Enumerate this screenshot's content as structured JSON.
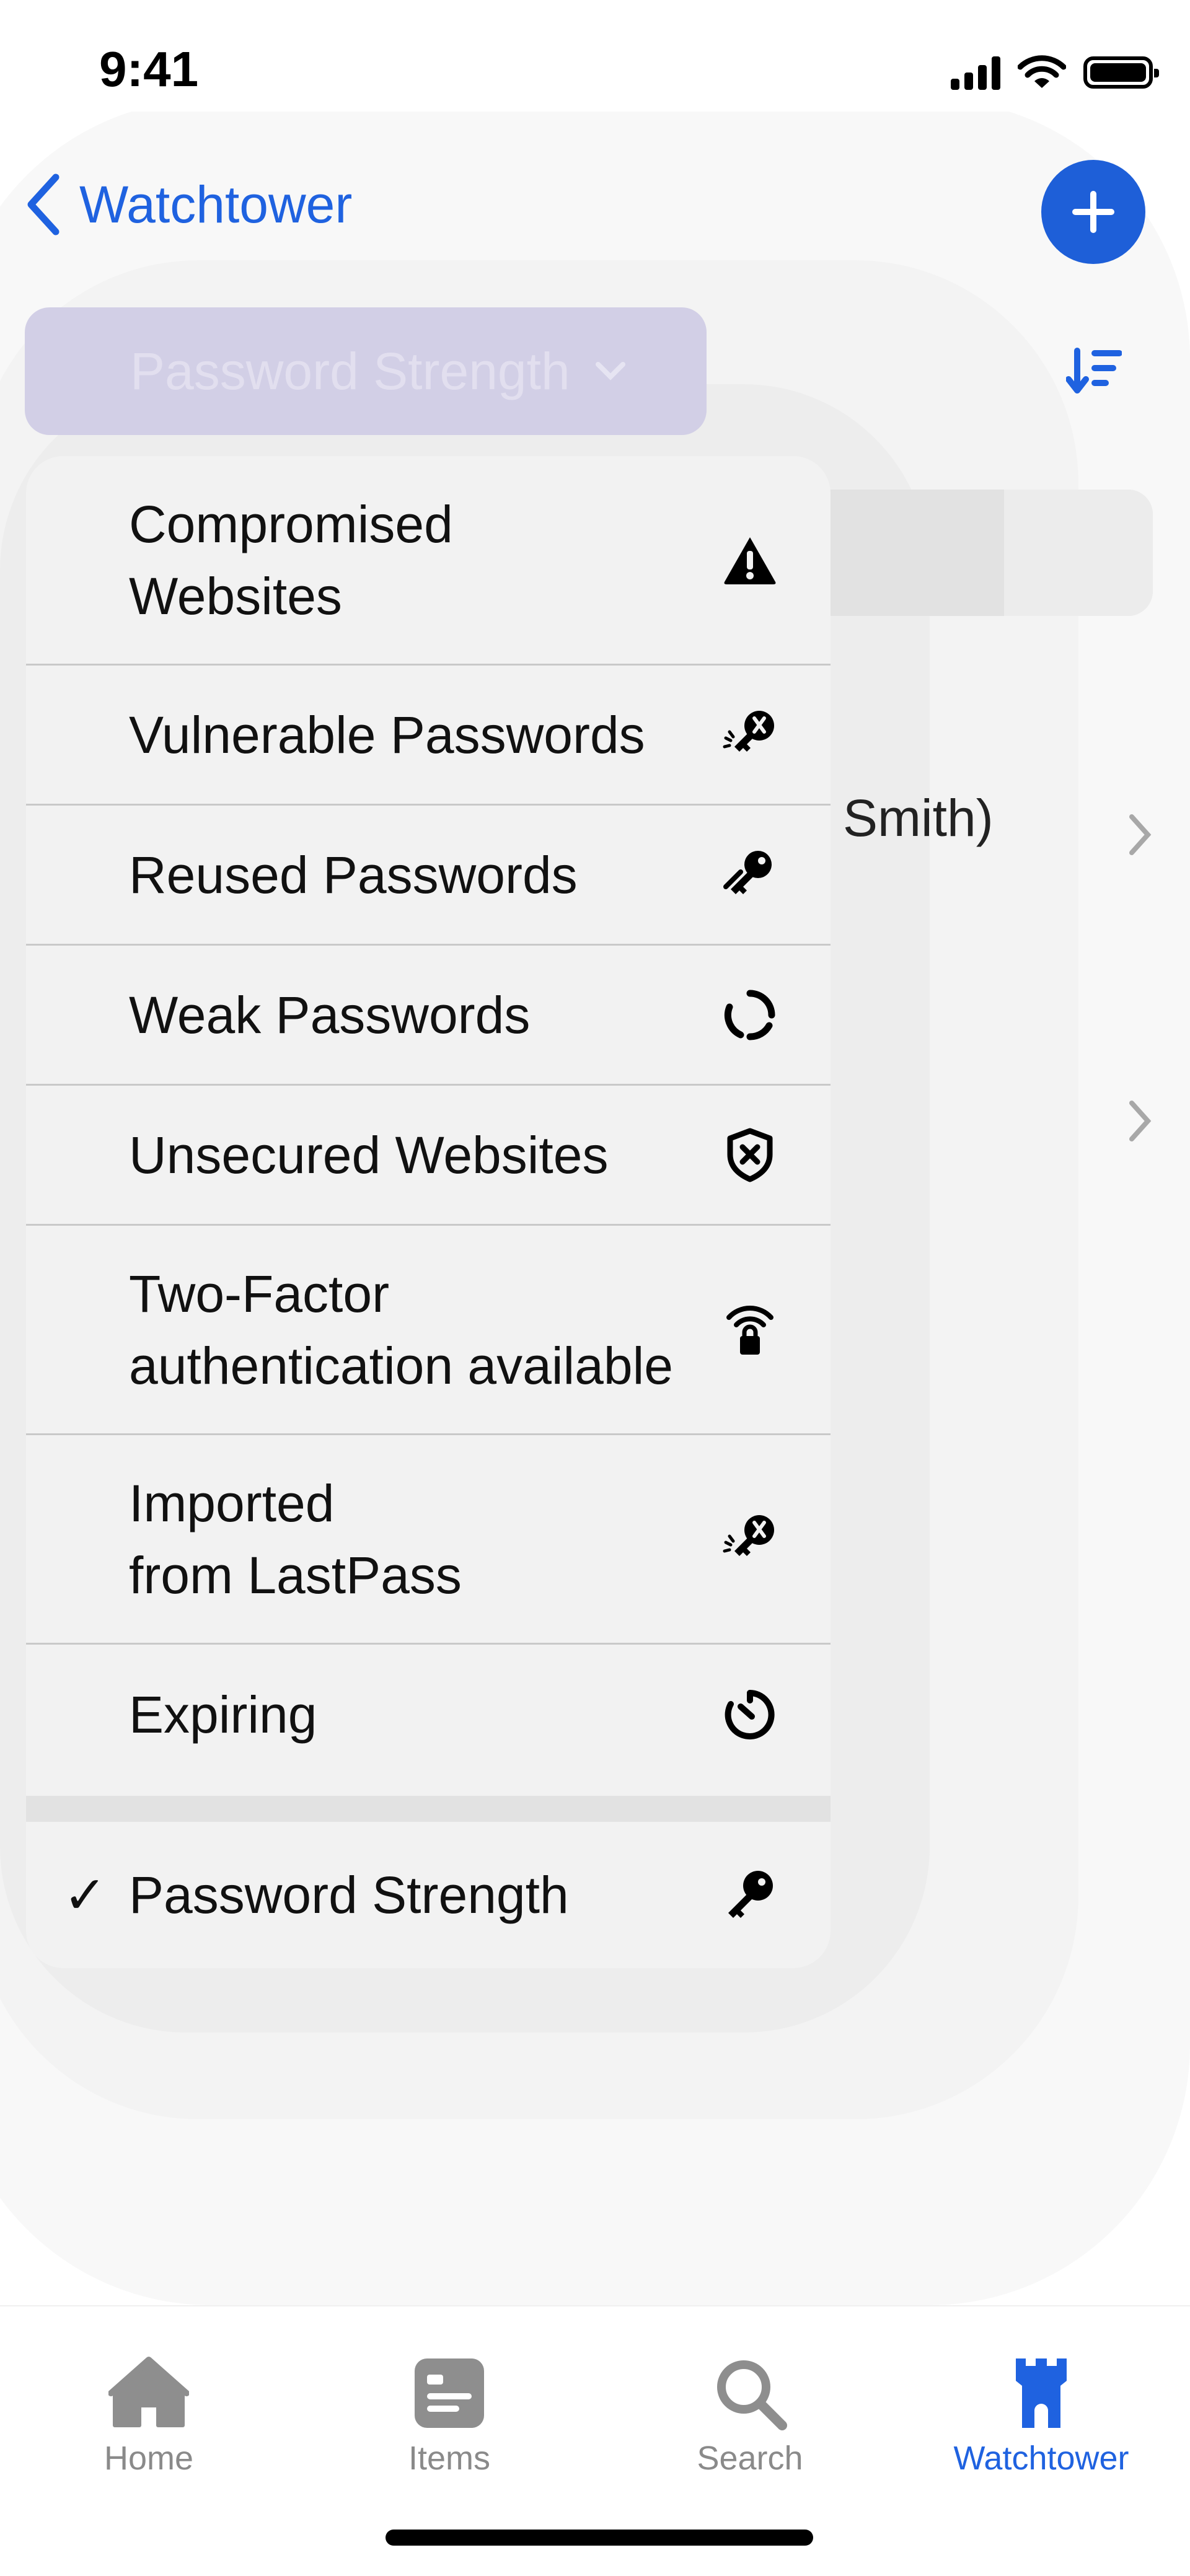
{
  "status_bar": {
    "time": "9:41"
  },
  "nav": {
    "back_label": "Watchtower"
  },
  "filter": {
    "selected_label": "Password Strength"
  },
  "background_list": {
    "row_text": "Smith)"
  },
  "menu": {
    "items": [
      {
        "label": "Compromised\nWebsites",
        "icon": "warning-triangle-icon"
      },
      {
        "label": "Vulnerable Passwords",
        "icon": "broken-key-icon"
      },
      {
        "label": "Reused Passwords",
        "icon": "double-key-icon"
      },
      {
        "label": "Weak Passwords",
        "icon": "broken-circle-icon"
      },
      {
        "label": "Unsecured Websites",
        "icon": "shield-x-icon"
      },
      {
        "label": "Two-Factor\nauthentication available",
        "icon": "wifi-lock-icon"
      },
      {
        "label": "Imported\nfrom LastPass",
        "icon": "broken-key-icon"
      },
      {
        "label": "Expiring",
        "icon": "timer-icon"
      }
    ],
    "selected": {
      "label": "Password Strength",
      "check": "✓",
      "icon": "key-icon"
    }
  },
  "tab_bar": {
    "tabs": [
      {
        "label": "Home",
        "icon": "home-icon",
        "active": false
      },
      {
        "label": "Items",
        "icon": "items-icon",
        "active": false
      },
      {
        "label": "Search",
        "icon": "search-icon",
        "active": false
      },
      {
        "label": "Watchtower",
        "icon": "watchtower-icon",
        "active": true
      }
    ]
  },
  "colors": {
    "accent": "#1f62e0",
    "menu_bg": "#f2f2f2",
    "pill": "#d2cfe6"
  }
}
